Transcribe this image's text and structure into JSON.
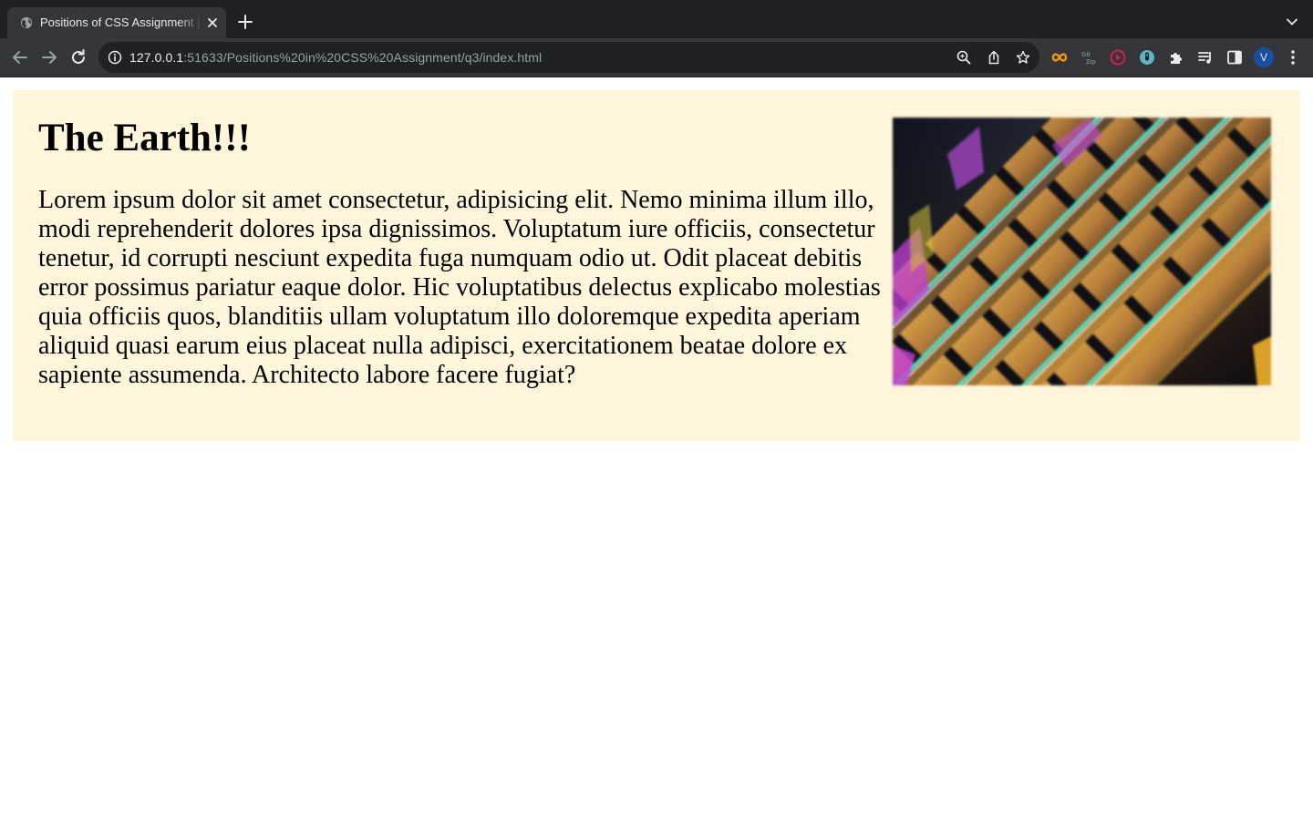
{
  "browser": {
    "tab_title": "Positions of CSS Assignment | ...",
    "url_host": "127.0.0.1",
    "url_rest": ":51633/Positions%20in%20CSS%20Assignment/q3/index.html",
    "profile_initial": "V",
    "colors": {
      "frame": "#1f2023",
      "toolbar": "#35363a",
      "omnibox": "#202124",
      "avatar": "#1a4fa0"
    },
    "icons": [
      "globe-icon",
      "close-icon",
      "plus-icon",
      "chevron-down-icon",
      "back-arrow-icon",
      "forward-arrow-icon",
      "reload-icon",
      "info-icon",
      "zoom-icon",
      "share-icon",
      "star-icon",
      "infinity-extension-icon",
      "gitzip-extension-icon",
      "youtube-extension-icon",
      "clock-extension-icon",
      "puzzle-icon",
      "media-queue-icon",
      "side-panel-icon",
      "kebab-menu-icon"
    ]
  },
  "page": {
    "heading": "The Earth!!!",
    "paragraph": "Lorem ipsum dolor sit amet consectetur, adipisicing elit. Nemo minima illum illo, modi reprehenderit dolores ipsa dignissimos. Voluptatum iure officiis, consectetur tenetur, id corrupti nesciunt expedita fuga numquam odio ut. Odit placeat debitis error possimus pariatur eaque dolor. Hic voluptatibus delectus explicabo molestias quia officiis quos, blanditiis ullam voluptatum illo doloremque expedita aperiam aliquid quasi earum eius placeat nulla adipisci, exercitationem beatae dolore ex sapiente assumenda. Architecto labore facere fugiat?",
    "colors": {
      "card_background": "#fff5da",
      "text": "#000000"
    }
  }
}
